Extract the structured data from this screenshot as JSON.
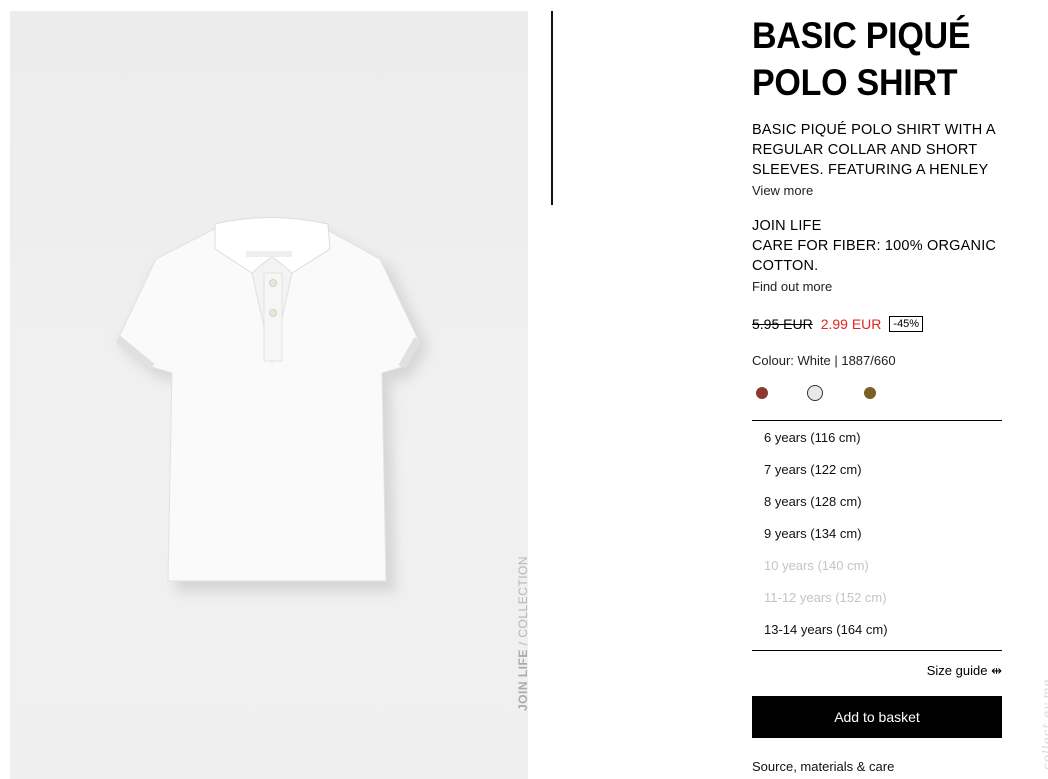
{
  "product": {
    "title": "BASIC PIQUÉ POLO SHIRT",
    "description": "BASIC PIQUÉ POLO SHIRT WITH A REGULAR COLLAR AND SHORT SLEEVES. FEATURING A HENLEY",
    "view_more": "View more",
    "join_life": "JOIN LIFE",
    "care_for_fiber": "CARE FOR FIBER: 100% ORGANIC COTTON.",
    "find_out_more": "Find out more"
  },
  "photo": {
    "label_bold": "JOIN LIFE",
    "label_rest": " / COLLECTION"
  },
  "pricing": {
    "old_price": "5.95 EUR",
    "new_price": "2.99 EUR",
    "discount": "-45%"
  },
  "colour": {
    "label": "Colour: White | 1887/660",
    "swatches": [
      {
        "name": "rust",
        "color": "#8a3a2e"
      },
      {
        "name": "white",
        "color": "#e8e8e8",
        "selected": true
      },
      {
        "name": "olive",
        "color": "#7a5e22"
      }
    ]
  },
  "sizes": [
    {
      "label": "6 years (116 cm)",
      "available": true
    },
    {
      "label": "7 years (122 cm)",
      "available": true
    },
    {
      "label": "8 years (128 cm)",
      "available": true
    },
    {
      "label": "9 years (134 cm)",
      "available": true
    },
    {
      "label": "10 years (140 cm)",
      "available": false
    },
    {
      "label": "11-12 years (152 cm)",
      "available": false
    },
    {
      "label": "13-14 years (164 cm)",
      "available": true
    }
  ],
  "size_guide": "Size guide",
  "size_guide_icon": "resize-horizontal-icon",
  "add_to_basket": "Add to basket",
  "source_link": "Source, materials & care",
  "watermark": "collect.ey.me"
}
